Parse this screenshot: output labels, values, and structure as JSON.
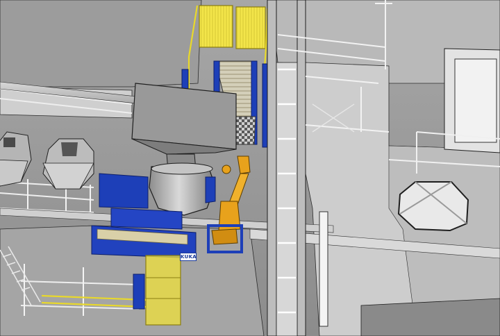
{
  "scene": {
    "colors": {
      "structure_light": "#cfcfcf",
      "structure_mid": "#a9a9a9",
      "structure_dark": "#6e6e6e",
      "equipment_blue": "#1d3fb8",
      "safety_yellow": "#f0e23a",
      "robot_orange": "#e8a21c",
      "outline": "#1e1e1e"
    },
    "equipment_plate_label": "KUKA"
  }
}
